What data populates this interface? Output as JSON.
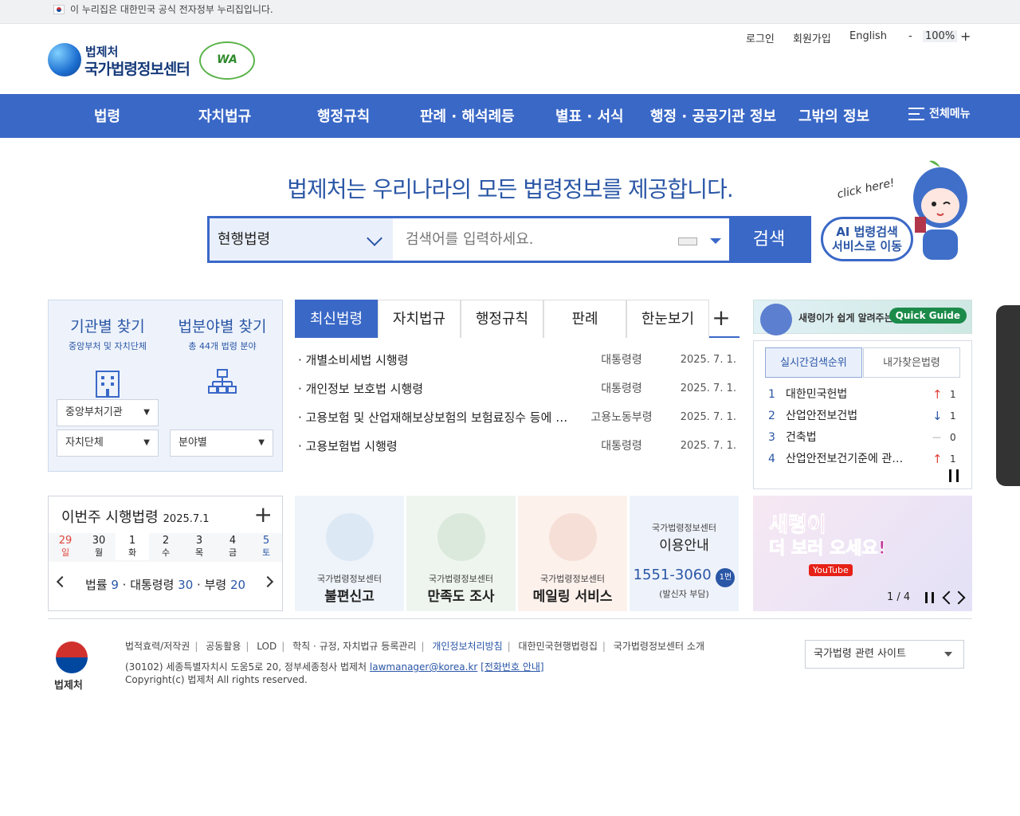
{
  "gov_notice": "이 누리집은 대한민국 공식 전자정부 누리집입니다.",
  "logo": {
    "org": "법제처",
    "title": "국가법령정보센터",
    "badge": "WA"
  },
  "utils": {
    "login": "로그인",
    "signup": "회원가입",
    "english": "English",
    "minus": "-",
    "zoom": "100%",
    "plus": "+"
  },
  "gnb": [
    "법령",
    "자치법규",
    "행정규칙",
    "판례 · 해석례등",
    "별표 · 서식",
    "행정 · 공공기관 정보",
    "그밖의 정보"
  ],
  "gnb_all": "전체메뉴",
  "headline": "법제처는 우리나라의 모든 법령정보를 제공합니다.",
  "search": {
    "scope": "현행법령",
    "placeholder": "검색어를 입력하세요.",
    "button": "검색"
  },
  "ai": {
    "click": "click here!",
    "line1": "AI 법령검색",
    "line2": "서비스로 이동"
  },
  "finder": {
    "org": {
      "title": "기관별 찾기",
      "sub": "중앙부처 및 자치단체",
      "sel1": "중앙부처기관",
      "sel2": "자치단체"
    },
    "field": {
      "title": "법분야별 찾기",
      "sub": "총 44개 법령 분야",
      "sel": "분야별"
    }
  },
  "tabs": [
    "최신법령",
    "자치법규",
    "행정규칙",
    "판례",
    "한눈보기"
  ],
  "tabs_more": "+",
  "new_laws": [
    {
      "name": "· 개별소비세법 시행령",
      "type": "대통령령",
      "date": "2025. 7. 1."
    },
    {
      "name": "· 개인정보 보호법 시행령",
      "type": "대통령령",
      "date": "2025. 7. 1."
    },
    {
      "name": "· 고용보험 및 산업재해보상보험의 보험료징수 등에 관한 법률 시행규칙",
      "type": "고용노동부령",
      "date": "2025. 7. 1."
    },
    {
      "name": "· 고용보험법 시행령",
      "type": "대통령령",
      "date": "2025. 7. 1."
    }
  ],
  "quick_guide": {
    "text": "새령이가 쉽게 알려주는 국법",
    "button": "Quick Guide"
  },
  "rank": {
    "tab1": "실시간검색순위",
    "tab2": "내가찾은법령",
    "items": [
      {
        "no": "1",
        "name": "대한민국헌법",
        "arrow": "↑",
        "count": "1",
        "color": "#e0453b"
      },
      {
        "no": "2",
        "name": "산업안전보건법",
        "arrow": "↓",
        "count": "1",
        "color": "#2a56a6"
      },
      {
        "no": "3",
        "name": "건축법",
        "arrow": "—",
        "count": "0",
        "color": "#999999"
      },
      {
        "no": "4",
        "name": "산업안전보건기준에 관한 규칙",
        "arrow": "↑",
        "count": "1",
        "color": "#e0453b"
      }
    ]
  },
  "week": {
    "title": "이번주 시행법령",
    "date": "2025.7.1",
    "plus": "+",
    "days": [
      {
        "d": "29",
        "w": "일",
        "c": "#e0453b"
      },
      {
        "d": "30",
        "w": "월",
        "c": "#333333"
      },
      {
        "d": "1",
        "w": "화",
        "c": "#333333"
      },
      {
        "d": "2",
        "w": "수",
        "c": "#333333"
      },
      {
        "d": "3",
        "w": "목",
        "c": "#333333"
      },
      {
        "d": "4",
        "w": "금",
        "c": "#333333"
      },
      {
        "d": "5",
        "w": "토",
        "c": "#2a56a6"
      }
    ],
    "counts": [
      {
        "k": "법률",
        "v": "9"
      },
      {
        "k": "대통령령",
        "v": "30"
      },
      {
        "k": "부령",
        "v": "20"
      }
    ]
  },
  "cards": [
    {
      "sub": "국가법령정보센터",
      "main": "불편신고",
      "bg": "#eef4fa"
    },
    {
      "sub": "국가법령정보센터",
      "main": "만족도 조사",
      "bg": "#eef5ee"
    },
    {
      "sub": "국가법령정보센터",
      "main": "메일링 서비스",
      "bg": "#fdf1ec"
    },
    {
      "sub": "국가법령정보센터",
      "main": "이용안내",
      "phone": "1551-3060",
      "badge": "1번",
      "note": "(발신자 부담)",
      "bg": "#eef2fa"
    }
  ],
  "banner": {
    "line1": "새령이",
    "line2": "더 보러 오세요!",
    "yt": "YouTube",
    "page": "1 / 4"
  },
  "footer": {
    "links": [
      "법적효력/저작권",
      "공동활용",
      "LOD",
      "학칙 · 규정, 자치법규 등록관리",
      "개인정보처리방침",
      "대한민국현행법령집",
      "국가법령정보센터 소개"
    ],
    "addr": "(30102) 세종특별자치시 도움5로 20, 정부세종청사 법제처",
    "email": "lawmanager@korea.kr",
    "phone_link": "[전화번호 안내]",
    "copy": "Copyright(c) 법제처 All rights reserved.",
    "name": "법제처",
    "site_select": "국가법령 관련 사이트"
  }
}
